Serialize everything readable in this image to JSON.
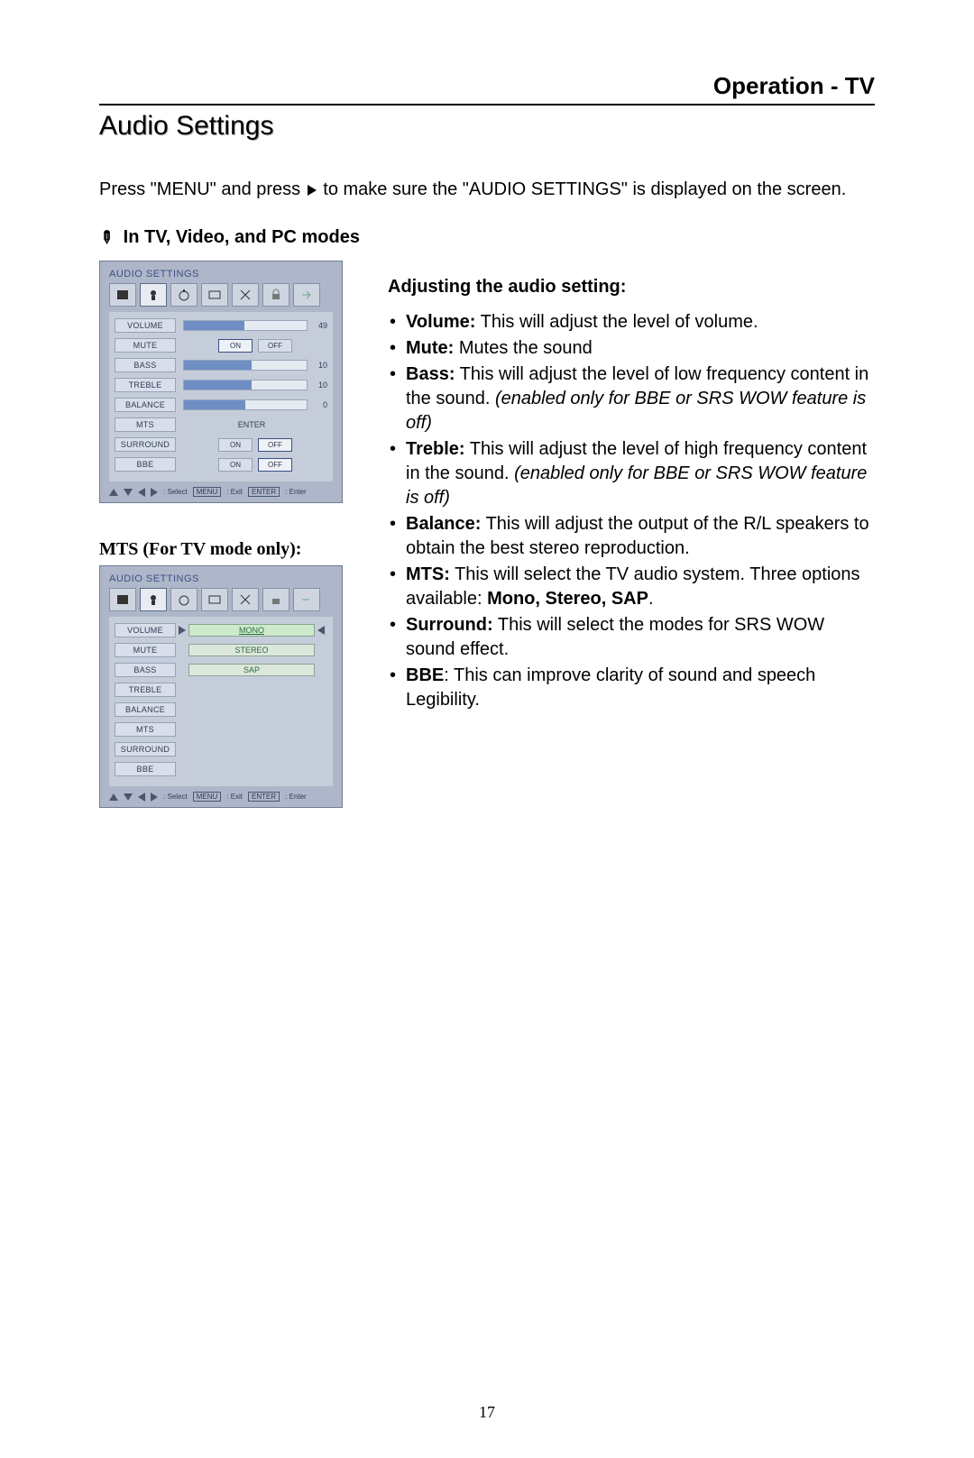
{
  "header": {
    "title": "Operation - TV"
  },
  "section_title": "Audio Settings",
  "intro_parts": {
    "a": "Press \"MENU\" and press",
    "b": "to make sure the \"AUDIO SETTINGS\" is displayed on the screen."
  },
  "modes_title": "In TV, Video, and PC modes",
  "osd1": {
    "title": "AUDIO SETTINGS",
    "rows": {
      "volume": {
        "label": "VOLUME",
        "value": "49",
        "fill": 49
      },
      "mute": {
        "label": "MUTE",
        "on": "ON",
        "off": "OFF",
        "sel": "on"
      },
      "bass": {
        "label": "BASS",
        "value": "10",
        "fill": 55
      },
      "treble": {
        "label": "TREBLE",
        "value": "10",
        "fill": 55
      },
      "balance": {
        "label": "BALANCE",
        "value": "0",
        "fill": 50
      },
      "mts": {
        "label": "MTS",
        "enter": "ENTER"
      },
      "surround": {
        "label": "SURROUND",
        "on": "ON",
        "off": "OFF",
        "sel": "off"
      },
      "bbe": {
        "label": "BBE",
        "on": "ON",
        "off": "OFF",
        "sel": "off"
      }
    },
    "foot": {
      "select": ": Select",
      "menu": "MENU",
      "exit": ": Exit",
      "enter": "ENTER",
      "enter_lbl": ": Enter"
    }
  },
  "mts_heading": "MTS (For TV mode only):",
  "osd2": {
    "title": "AUDIO SETTINGS",
    "labels": [
      "VOLUME",
      "MUTE",
      "BASS",
      "TREBLE",
      "BALANCE",
      "MTS",
      "SURROUND",
      "BBE"
    ],
    "options": {
      "mono": "MONO",
      "stereo": "STEREO",
      "sap": "SAP"
    },
    "foot": {
      "select": ": Select",
      "menu": "MENU",
      "exit": ": Exit",
      "enter": "ENTER",
      "enter_lbl": ": Enter"
    }
  },
  "right": {
    "heading": "Adjusting the audio setting:",
    "items": {
      "volume": {
        "b": "Volume:",
        "t": " This will adjust the level of volume."
      },
      "mute": {
        "b": "Mute:",
        "t": "  Mutes the sound"
      },
      "bass": {
        "b": "Bass:",
        "t": " This will adjust the level of low frequency content in the sound.",
        "i": " (enabled only for BBE or SRS WOW feature is off)"
      },
      "treble": {
        "b": "Treble:",
        "t": " This will adjust the level of high frequency content in the sound.",
        "i": " (enabled only for BBE or SRS WOW feature is off)"
      },
      "balance": {
        "b": "Balance:",
        "t": " This will adjust the output of the R/L speakers to obtain the best stereo reproduction."
      },
      "mts": {
        "b": "MTS:",
        "t": " This will select the TV audio system. Three options available: ",
        "b2": "Mono, Stereo, SAP",
        "t2": "."
      },
      "surround": {
        "b": "Surround:",
        "t": " This will select the modes for SRS WOW sound effect."
      },
      "bbe": {
        "b": "BBE",
        "t": ": This can improve clarity of sound and speech Legibility."
      }
    }
  },
  "page_number": "17"
}
